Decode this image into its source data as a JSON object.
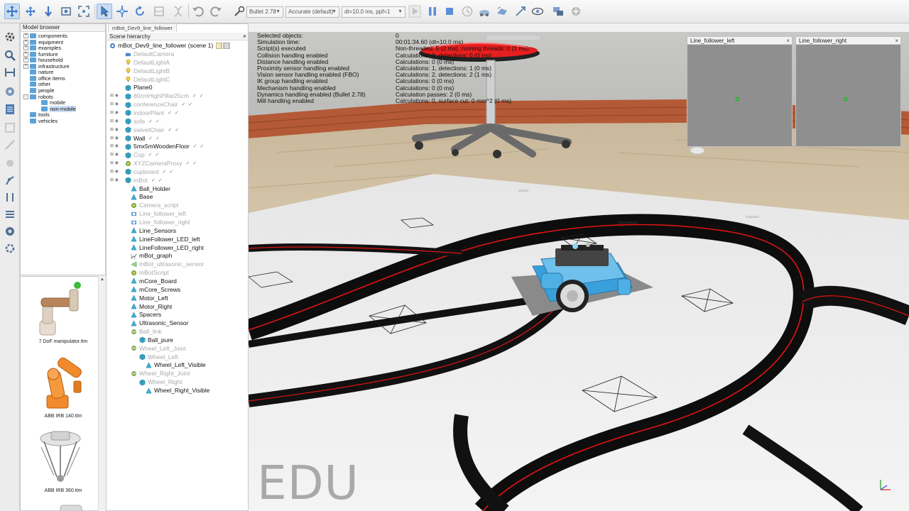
{
  "toolbar": {
    "engine": "Bullet 2.78",
    "accuracy": "Accurate (default)",
    "timestep": "dt=10.0 ms, ppf=1"
  },
  "model_browser": {
    "title": "Model browser",
    "items": [
      {
        "label": "components",
        "level": 1,
        "expander": "+"
      },
      {
        "label": "equipment",
        "level": 1,
        "expander": "+"
      },
      {
        "label": "examples",
        "level": 1,
        "expander": "+"
      },
      {
        "label": "furniture",
        "level": 1,
        "expander": "+"
      },
      {
        "label": "household",
        "level": 1,
        "expander": "+"
      },
      {
        "label": "infrastructure",
        "level": 1,
        "expander": "+"
      },
      {
        "label": "nature",
        "level": 1,
        "expander": ""
      },
      {
        "label": "office items",
        "level": 1,
        "expander": ""
      },
      {
        "label": "other",
        "level": 1,
        "expander": ""
      },
      {
        "label": "people",
        "level": 1,
        "expander": ""
      },
      {
        "label": "robots",
        "level": 1,
        "expander": "-"
      },
      {
        "label": "mobile",
        "level": 2,
        "expander": ""
      },
      {
        "label": "non-mobile",
        "level": 2,
        "expander": "",
        "selected": true
      },
      {
        "label": "tools",
        "level": 1,
        "expander": ""
      },
      {
        "label": "vehicles",
        "level": 1,
        "expander": ""
      }
    ],
    "thumbnails": [
      {
        "label": "7 DoF manipulator.ttm"
      },
      {
        "label": "ABB IRB 140.ttm"
      },
      {
        "label": "ABB IRB 360.ttm"
      }
    ]
  },
  "scene": {
    "tab": "mBot_Dev9_line_follower",
    "title": "Scene hierarchy",
    "close": "×",
    "root": "mBot_Dev9_line_follower (scene 1)",
    "nodes": [
      {
        "label": "DefaultCamera",
        "depth": 1,
        "icon": "camera",
        "dim": true
      },
      {
        "label": "DefaultLightA",
        "depth": 1,
        "icon": "light",
        "dim": true
      },
      {
        "label": "DefaultLightB",
        "depth": 1,
        "icon": "light",
        "dim": true
      },
      {
        "label": "DefaultLightC",
        "depth": 1,
        "icon": "light",
        "dim": true
      },
      {
        "label": "Plane0",
        "depth": 1,
        "icon": "shape",
        "dim": false
      },
      {
        "label": "80cmHighPillar25cm",
        "depth": 1,
        "icon": "shape",
        "dim": true,
        "exp": true
      },
      {
        "label": "conferenceChair",
        "depth": 1,
        "icon": "shape",
        "dim": true,
        "exp": true
      },
      {
        "label": "indoorPlant",
        "depth": 1,
        "icon": "shape",
        "dim": true,
        "exp": true
      },
      {
        "label": "sofa",
        "depth": 1,
        "icon": "shape",
        "dim": true,
        "exp": true
      },
      {
        "label": "swivelChair",
        "depth": 1,
        "icon": "shape",
        "dim": true,
        "exp": true
      },
      {
        "label": "Wall",
        "depth": 1,
        "icon": "shape",
        "dim": false,
        "exp": true
      },
      {
        "label": "5mx5mWoodenFloor",
        "depth": 1,
        "icon": "shape",
        "dim": false,
        "exp": true
      },
      {
        "label": "Cup",
        "depth": 1,
        "icon": "shape",
        "dim": true,
        "exp": true
      },
      {
        "label": "XYZCameraProxy",
        "depth": 1,
        "icon": "script",
        "dim": true,
        "exp": true
      },
      {
        "label": "cupboard",
        "depth": 1,
        "icon": "shape",
        "dim": true,
        "exp": true
      },
      {
        "label": "mBot",
        "depth": 1,
        "icon": "shape",
        "dim": true,
        "exp": true
      },
      {
        "label": "Ball_Holder",
        "depth": 2,
        "icon": "pure",
        "dim": false
      },
      {
        "label": "Base",
        "depth": 2,
        "icon": "pure",
        "dim": false
      },
      {
        "label": "Camera_script",
        "depth": 2,
        "icon": "script",
        "dim": true
      },
      {
        "label": "Line_follower_left",
        "depth": 2,
        "icon": "vision",
        "dim": true
      },
      {
        "label": "Line_follower_right",
        "depth": 2,
        "icon": "vision",
        "dim": true
      },
      {
        "label": "Line_Sensors",
        "depth": 2,
        "icon": "pure",
        "dim": false
      },
      {
        "label": "LineFollower_LED_left",
        "depth": 2,
        "icon": "pure",
        "dim": false
      },
      {
        "label": "LineFollower_LED_right",
        "depth": 2,
        "icon": "pure",
        "dim": false
      },
      {
        "label": "mBot_graph",
        "depth": 2,
        "icon": "graph",
        "dim": false
      },
      {
        "label": "mBot_ultrasonic_sensor",
        "depth": 2,
        "icon": "sensor",
        "dim": true
      },
      {
        "label": "mBotScript",
        "depth": 2,
        "icon": "script",
        "dim": true
      },
      {
        "label": "mCore_Board",
        "depth": 2,
        "icon": "pure",
        "dim": false
      },
      {
        "label": "mCore_Screws",
        "depth": 2,
        "icon": "pure",
        "dim": false
      },
      {
        "label": "Motor_Left",
        "depth": 2,
        "icon": "pure",
        "dim": false
      },
      {
        "label": "Motor_Right",
        "depth": 2,
        "icon": "pure",
        "dim": false
      },
      {
        "label": "Spacers",
        "depth": 2,
        "icon": "pure",
        "dim": false
      },
      {
        "label": "Ultrasonic_Sensor",
        "depth": 2,
        "icon": "pure",
        "dim": false
      },
      {
        "label": "Ball_link",
        "depth": 2,
        "icon": "joint",
        "dim": true
      },
      {
        "label": "Ball_pure",
        "depth": 3,
        "icon": "shape",
        "dim": false
      },
      {
        "label": "Wheel_Left_Joint",
        "depth": 2,
        "icon": "joint",
        "dim": true
      },
      {
        "label": "Wheel_Left",
        "depth": 3,
        "icon": "shape",
        "dim": true
      },
      {
        "label": "Wheel_Left_Visible",
        "depth": 4,
        "icon": "pure",
        "dim": false
      },
      {
        "label": "Wheel_Right_Joint",
        "depth": 2,
        "icon": "joint",
        "dim": true
      },
      {
        "label": "Wheel_Right",
        "depth": 3,
        "icon": "shape",
        "dim": true
      },
      {
        "label": "Wheel_Right_Visible",
        "depth": 4,
        "icon": "pure",
        "dim": false
      }
    ]
  },
  "info": [
    {
      "k": "Selected objects:",
      "v": "0"
    },
    {
      "k": "Simulation time:",
      "v": "00:01:34.60 (dt=10.0 ms)"
    },
    {
      "k": "Script(s) executed",
      "v": "Non-threaded: 5 (2 ms), running threads: 0 (1 ms)"
    },
    {
      "k": "Collision handling enabled",
      "v": "Calculations: 0, detections: 0 (0 ms)"
    },
    {
      "k": "Distance handling enabled",
      "v": "Calculations: 0 (0 ms)"
    },
    {
      "k": "Proximity sensor handling enabled",
      "v": "Calculations: 1, detections: 1 (0 ms)"
    },
    {
      "k": "Vision sensor handling enabled (FBO)",
      "v": "Calculations: 2, detections: 2 (1 ms)"
    },
    {
      "k": "IK group handling enabled",
      "v": "Calculations: 0 (0 ms)"
    },
    {
      "k": "Mechanism handling enabled",
      "v": "Calculations: 0 (0 ms)"
    },
    {
      "k": "Dynamics handling enabled (Bullet 2.78)",
      "v": "Calculation passes: 2 (0 ms)"
    },
    {
      "k": "Mill handling enabled",
      "v": "Calculations: 0, surface cut: 0 mm^2 (0 ms)"
    }
  ],
  "views": {
    "left": "Line_follower_left",
    "right": "Line_follower_right",
    "close": "×"
  },
  "watermark": "EDU"
}
